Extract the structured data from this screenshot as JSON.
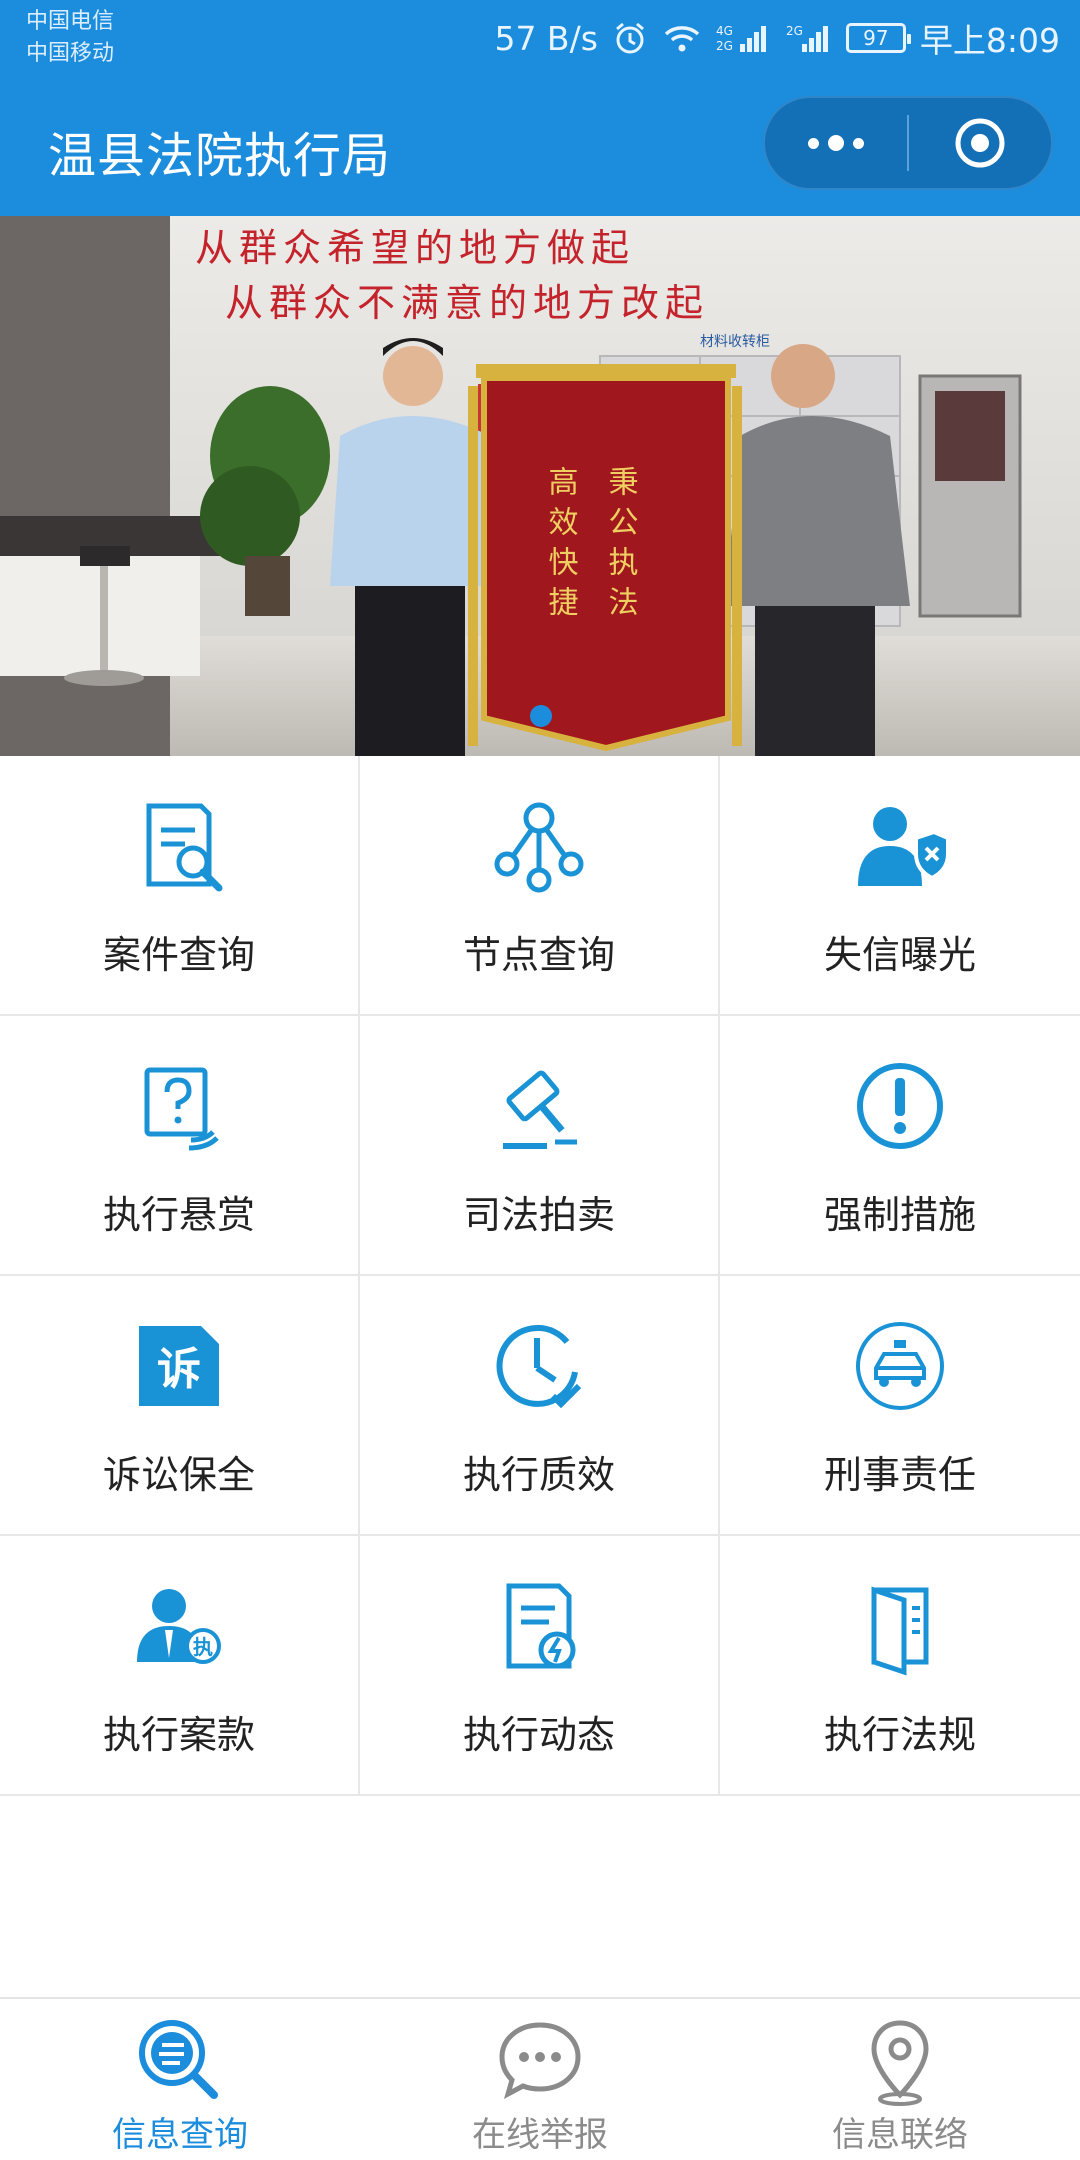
{
  "status_bar": {
    "carrier_1": "中国电信",
    "carrier_2": "中国移动",
    "net_speed": "57 B/s",
    "network_4g": "4G 2G",
    "network_2g": "2G",
    "battery": "97",
    "time": "早上8:09"
  },
  "header": {
    "title": "温县法院执行局",
    "more_icon": "more-dots-icon",
    "close_icon": "target-circle-icon",
    "bg_color": "#1c8cdc"
  },
  "banner": {
    "slogan_line_1": "从群众希望的地方做起",
    "slogan_line_2": "从群众不满意的地方改起",
    "counter_sign": "材料收转柜",
    "banner_left_col": "高效快捷",
    "banner_right_col": "秉公执法",
    "active_slide": 1,
    "slide_count": 1
  },
  "grid": {
    "items": [
      {
        "label": "案件查询",
        "icon": "document-search-icon"
      },
      {
        "label": "节点查询",
        "icon": "node-tree-icon"
      },
      {
        "label": "失信曝光",
        "icon": "user-blocked-icon"
      },
      {
        "label": "执行悬赏",
        "icon": "question-card-icon"
      },
      {
        "label": "司法拍卖",
        "icon": "gavel-icon"
      },
      {
        "label": "强制措施",
        "icon": "exclamation-circle-icon"
      },
      {
        "label": "诉讼保全",
        "icon": "lawsuit-badge-icon"
      },
      {
        "label": "执行质效",
        "icon": "clock-check-icon"
      },
      {
        "label": "刑事责任",
        "icon": "police-car-icon"
      },
      {
        "label": "执行案款",
        "icon": "officer-badge-icon"
      },
      {
        "label": "执行动态",
        "icon": "document-lightning-icon"
      },
      {
        "label": "执行法规",
        "icon": "law-book-icon"
      }
    ]
  },
  "tabbar": {
    "tabs": [
      {
        "label": "信息查询",
        "icon": "search-list-icon",
        "active": true
      },
      {
        "label": "在线举报",
        "icon": "chat-bubble-icon",
        "active": false
      },
      {
        "label": "信息联络",
        "icon": "location-pin-icon",
        "active": false
      }
    ]
  },
  "colors": {
    "primary": "#1c8cdc",
    "icon_blue": "#1a93d6",
    "inactive_tab": "#8b8b8b"
  }
}
